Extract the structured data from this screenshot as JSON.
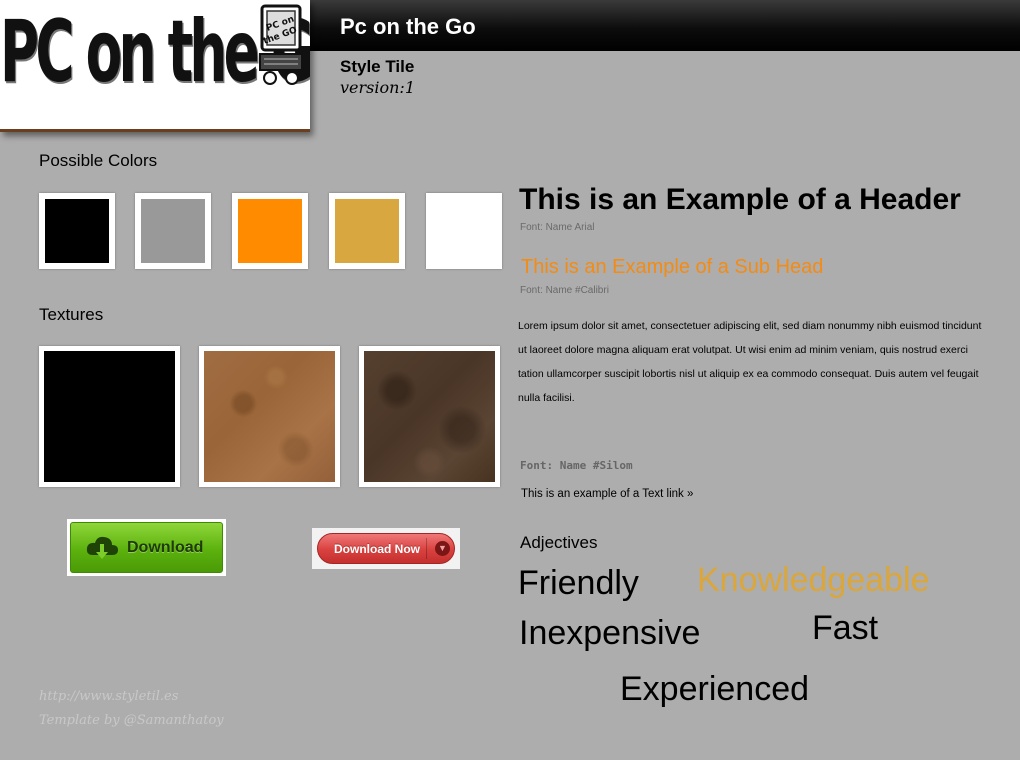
{
  "app": {
    "title": "Pc on the Go"
  },
  "logo": {
    "text": "PC on the GO",
    "badge_text": "PC on the GO"
  },
  "tile": {
    "name": "Style Tile",
    "version": "version:1"
  },
  "colors_section": {
    "label": "Possible Colors",
    "swatches": [
      "#000000",
      "#999999",
      "#ff8c00",
      "#d9a740",
      "#ffffff"
    ]
  },
  "textures_section": {
    "label": "Textures",
    "items": [
      "black",
      "cardboard",
      "leather"
    ]
  },
  "buttons": {
    "green_download": "Download",
    "red_download": "Download Now"
  },
  "typography": {
    "header_example": "This is an Example of a Header",
    "header_font_note": "Font: Name Arial",
    "subhead_example": "This is an Example of a Sub Head",
    "subhead_font_note": "Font: Name #Calibri",
    "body_text": "Lorem ipsum dolor sit amet, consectetuer adipiscing elit, sed diam nonummy nibh euismod tincidunt ut laoreet dolore magna aliquam erat volutpat. Ut wisi enim ad minim veniam, quis nostrud exerci tation ullamcorper suscipit lobortis nisl ut aliquip ex ea commodo consequat. Duis autem vel feugait nulla facilisi.",
    "body_font_note": "Font: Name #Silom",
    "text_link": "This is an example of a Text link »"
  },
  "adjectives": {
    "label": "Adjectives",
    "words": [
      "Friendly",
      "Knowledgeable",
      "Inexpensive",
      "Fast",
      "Experienced"
    ],
    "accent_color": "#dba63a"
  },
  "credits": {
    "url": "http://www.styletil.es",
    "author": "Template by @Samanthatoy"
  }
}
